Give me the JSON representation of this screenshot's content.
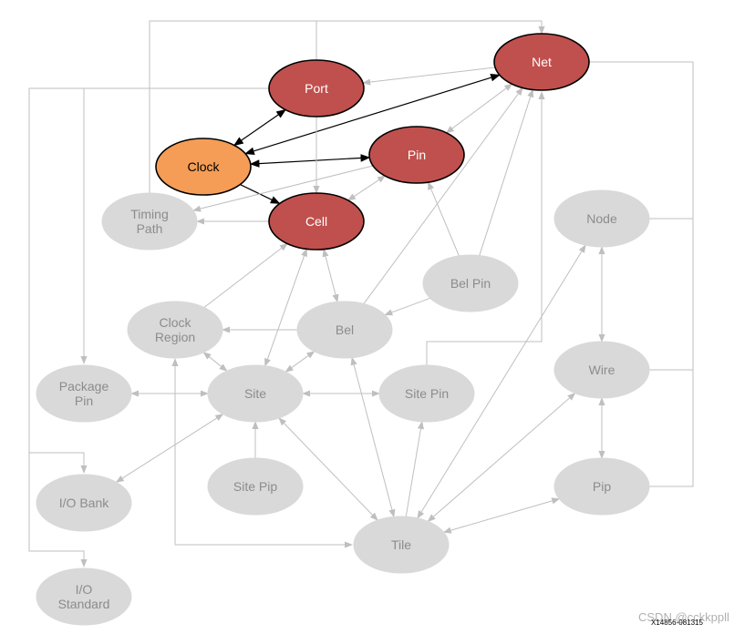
{
  "colors": {
    "primary": "#c0504d",
    "clock": "#f59d56",
    "secondary": "#d9d9d9",
    "secondary_text": "#8c8c8c",
    "edge_gray": "#bfbfbf",
    "edge_black": "#000000"
  },
  "nodes": [
    {
      "id": "port",
      "label": [
        "Port"
      ],
      "kind": "primary"
    },
    {
      "id": "net",
      "label": [
        "Net"
      ],
      "kind": "primary"
    },
    {
      "id": "clock",
      "label": [
        "Clock"
      ],
      "kind": "clock"
    },
    {
      "id": "pin",
      "label": [
        "Pin"
      ],
      "kind": "primary"
    },
    {
      "id": "cell",
      "label": [
        "Cell"
      ],
      "kind": "primary"
    },
    {
      "id": "timing_path",
      "label": [
        "Timing",
        "Path"
      ],
      "kind": "secondary"
    },
    {
      "id": "node",
      "label": [
        "Node"
      ],
      "kind": "secondary"
    },
    {
      "id": "bel_pin",
      "label": [
        "Bel Pin"
      ],
      "kind": "secondary"
    },
    {
      "id": "clock_region",
      "label": [
        "Clock",
        "Region"
      ],
      "kind": "secondary"
    },
    {
      "id": "bel",
      "label": [
        "Bel"
      ],
      "kind": "secondary"
    },
    {
      "id": "package_pin",
      "label": [
        "Package",
        "Pin"
      ],
      "kind": "secondary"
    },
    {
      "id": "site",
      "label": [
        "Site"
      ],
      "kind": "secondary"
    },
    {
      "id": "site_pin",
      "label": [
        "Site Pin"
      ],
      "kind": "secondary"
    },
    {
      "id": "wire",
      "label": [
        "Wire"
      ],
      "kind": "secondary"
    },
    {
      "id": "io_bank",
      "label": [
        "I/O Bank"
      ],
      "kind": "secondary"
    },
    {
      "id": "site_pip",
      "label": [
        "Site Pip"
      ],
      "kind": "secondary"
    },
    {
      "id": "pip",
      "label": [
        "Pip"
      ],
      "kind": "secondary"
    },
    {
      "id": "tile",
      "label": [
        "Tile"
      ],
      "kind": "secondary"
    },
    {
      "id": "io_standard",
      "label": [
        "I/O",
        "Standard"
      ],
      "kind": "secondary"
    }
  ],
  "edges": [
    {
      "from": "port",
      "to": "clock",
      "both": true,
      "black": true
    },
    {
      "from": "clock",
      "to": "net",
      "both": true,
      "black": true
    },
    {
      "from": "clock",
      "to": "pin",
      "both": true,
      "black": true
    },
    {
      "from": "clock",
      "to": "cell",
      "both": false,
      "black": true
    },
    {
      "from": "net",
      "to": "port",
      "both": false
    },
    {
      "from": "net",
      "to": "pin",
      "both": true
    },
    {
      "from": "pin",
      "to": "timing_path",
      "both": false
    },
    {
      "from": "cell",
      "to": "timing_path",
      "both": false
    },
    {
      "from": "pin",
      "to": "cell",
      "both": true
    },
    {
      "from": "port",
      "to": "cell",
      "both": false
    },
    {
      "from": "bel_pin",
      "to": "pin",
      "both": false
    },
    {
      "from": "bel_pin",
      "to": "net",
      "both": false
    },
    {
      "from": "bel_pin",
      "to": "bel",
      "both": false
    },
    {
      "from": "bel",
      "to": "net",
      "both": false
    },
    {
      "from": "cell",
      "to": "bel",
      "both": true
    },
    {
      "from": "cell",
      "to": "site",
      "both": true
    },
    {
      "from": "clock_region",
      "to": "cell",
      "both": false
    },
    {
      "from": "bel",
      "to": "clock_region",
      "both": false
    },
    {
      "from": "clock_region",
      "to": "site",
      "both": true
    },
    {
      "from": "site",
      "to": "bel",
      "both": true
    },
    {
      "from": "package_pin",
      "to": "site",
      "both": true
    },
    {
      "from": "io_bank",
      "to": "site",
      "both": true
    },
    {
      "from": "site_pip",
      "to": "site",
      "both": false
    },
    {
      "from": "site",
      "to": "tile",
      "both": true
    },
    {
      "from": "site_pin",
      "to": "site",
      "both": true
    },
    {
      "from": "tile",
      "to": "site_pin",
      "both": false
    },
    {
      "from": "bel",
      "to": "tile",
      "both": true
    },
    {
      "from": "node",
      "to": "wire",
      "both": true
    },
    {
      "from": "wire",
      "to": "pip",
      "both": true
    },
    {
      "from": "tile",
      "to": "node",
      "both": true
    },
    {
      "from": "tile",
      "to": "wire",
      "both": true
    },
    {
      "from": "tile",
      "to": "pip",
      "both": true
    }
  ],
  "figure_id": "X14856-081315",
  "watermark": "CSDN @cckkppll"
}
